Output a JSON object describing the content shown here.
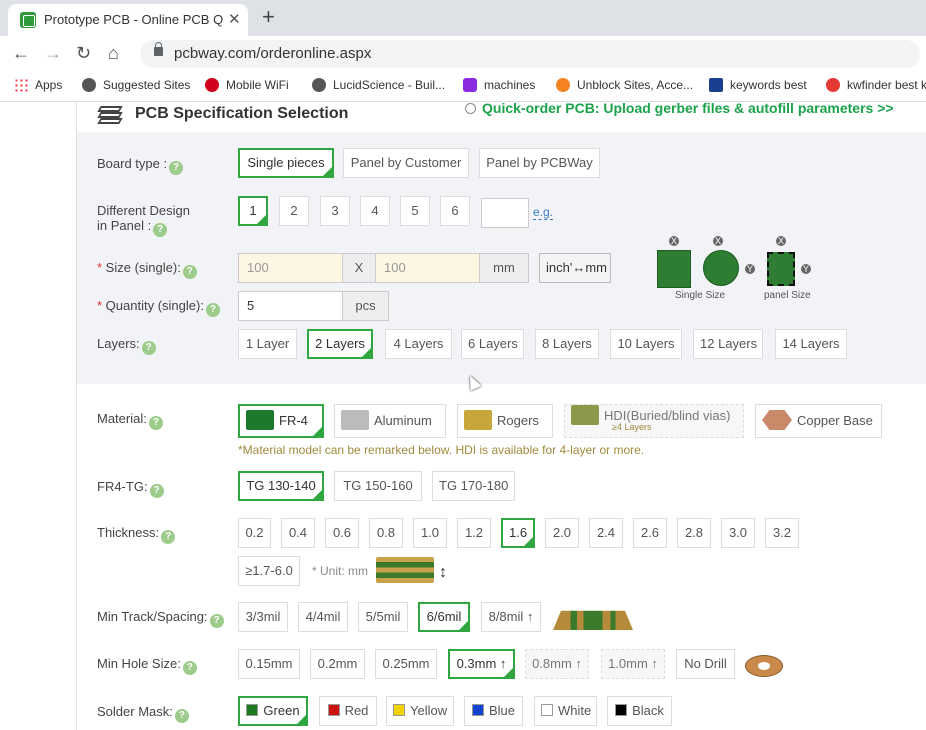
{
  "browser": {
    "tab_title": "Prototype PCB - Online PCB Quo",
    "url": "pcbway.com/orderonline.aspx",
    "bookmarks": [
      "Apps",
      "Suggested Sites",
      "Mobile WiFi",
      "LucidScience - Buil...",
      "machines",
      "Unblock Sites, Acce...",
      "keywords best",
      "kwfinder best k"
    ]
  },
  "header": {
    "title": "PCB Specification Selection",
    "quick_order": "Quick-order PCB: Upload gerber files & autofill parameters >>"
  },
  "board_type": {
    "label": "Board type :",
    "options": [
      "Single pieces",
      "Panel by Customer",
      "Panel by PCBWay"
    ],
    "selected": 0
  },
  "design": {
    "label_1": "Different Design",
    "label_2": "in Panel :",
    "options": [
      "1",
      "2",
      "3",
      "4",
      "5",
      "6"
    ],
    "selected": 0,
    "eg": "e.g."
  },
  "size": {
    "label": "Size (single):",
    "x_placeholder": "100",
    "sep": "X",
    "y_placeholder": "100",
    "unit": "mm",
    "toggle": "inch'↔mm"
  },
  "quantity": {
    "label": "Quantity (single):",
    "value": "5",
    "unit": "pcs"
  },
  "diagram": {
    "single": "Single Size",
    "panel": "panel Size"
  },
  "layers": {
    "label": "Layers:",
    "options": [
      "1 Layer",
      "2 Layers",
      "4 Layers",
      "6 Layers",
      "8 Layers",
      "10 Layers",
      "12 Layers",
      "14 Layers"
    ],
    "selected": 1
  },
  "material": {
    "label": "Material:",
    "options": [
      "FR-4",
      "Aluminum",
      "Rogers",
      "HDI(Buried/blind vias)",
      "Copper Base"
    ],
    "hdi_sub": "≥4 Layers",
    "selected": 0,
    "note": "*Material model can be remarked below. HDI is available for 4-layer or more."
  },
  "tg": {
    "label": "FR4-TG:",
    "options": [
      "TG 130-140",
      "TG 150-160",
      "TG 170-180"
    ],
    "selected": 0
  },
  "thickness": {
    "label": "Thickness:",
    "options": [
      "0.2",
      "0.4",
      "0.6",
      "0.8",
      "1.0",
      "1.2",
      "1.6",
      "2.0",
      "2.4",
      "2.6",
      "2.8",
      "3.0",
      "3.2"
    ],
    "extra": "≥1.7-6.0",
    "unit_note": "* Unit: mm",
    "selected": 6
  },
  "track": {
    "label": "Min Track/Spacing:",
    "options": [
      "3/3mil",
      "4/4mil",
      "5/5mil",
      "6/6mil",
      "8/8mil ↑"
    ],
    "selected": 3
  },
  "hole": {
    "label": "Min Hole Size:",
    "options": [
      "0.15mm",
      "0.2mm",
      "0.25mm",
      "0.3mm ↑",
      "0.8mm ↑",
      "1.0mm ↑",
      "No Drill"
    ],
    "selected": 3
  },
  "solder": {
    "label": "Solder Mask:",
    "options": [
      "Green",
      "Red",
      "Yellow",
      "Blue",
      "White",
      "Black"
    ],
    "colors": [
      "#1f7a1f",
      "#cc1111",
      "#f2d200",
      "#1144cc",
      "#ffffff",
      "#000000"
    ],
    "selected": 0
  }
}
